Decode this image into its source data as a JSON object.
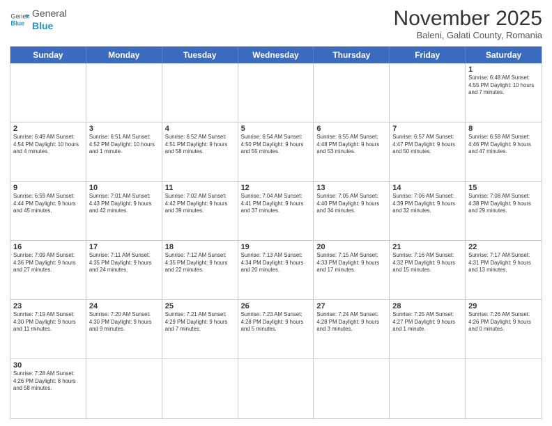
{
  "header": {
    "logo_general": "General",
    "logo_blue": "Blue",
    "month": "November 2025",
    "location": "Baleni, Galati County, Romania"
  },
  "weekdays": [
    "Sunday",
    "Monday",
    "Tuesday",
    "Wednesday",
    "Thursday",
    "Friday",
    "Saturday"
  ],
  "weeks": [
    [
      {
        "day": "",
        "info": ""
      },
      {
        "day": "",
        "info": ""
      },
      {
        "day": "",
        "info": ""
      },
      {
        "day": "",
        "info": ""
      },
      {
        "day": "",
        "info": ""
      },
      {
        "day": "",
        "info": ""
      },
      {
        "day": "1",
        "info": "Sunrise: 6:48 AM\nSunset: 4:55 PM\nDaylight: 10 hours and 7 minutes."
      }
    ],
    [
      {
        "day": "2",
        "info": "Sunrise: 6:49 AM\nSunset: 4:54 PM\nDaylight: 10 hours and 4 minutes."
      },
      {
        "day": "3",
        "info": "Sunrise: 6:51 AM\nSunset: 4:52 PM\nDaylight: 10 hours and 1 minute."
      },
      {
        "day": "4",
        "info": "Sunrise: 6:52 AM\nSunset: 4:51 PM\nDaylight: 9 hours and 58 minutes."
      },
      {
        "day": "5",
        "info": "Sunrise: 6:54 AM\nSunset: 4:50 PM\nDaylight: 9 hours and 55 minutes."
      },
      {
        "day": "6",
        "info": "Sunrise: 6:55 AM\nSunset: 4:48 PM\nDaylight: 9 hours and 53 minutes."
      },
      {
        "day": "7",
        "info": "Sunrise: 6:57 AM\nSunset: 4:47 PM\nDaylight: 9 hours and 50 minutes."
      },
      {
        "day": "8",
        "info": "Sunrise: 6:58 AM\nSunset: 4:46 PM\nDaylight: 9 hours and 47 minutes."
      }
    ],
    [
      {
        "day": "9",
        "info": "Sunrise: 6:59 AM\nSunset: 4:44 PM\nDaylight: 9 hours and 45 minutes."
      },
      {
        "day": "10",
        "info": "Sunrise: 7:01 AM\nSunset: 4:43 PM\nDaylight: 9 hours and 42 minutes."
      },
      {
        "day": "11",
        "info": "Sunrise: 7:02 AM\nSunset: 4:42 PM\nDaylight: 9 hours and 39 minutes."
      },
      {
        "day": "12",
        "info": "Sunrise: 7:04 AM\nSunset: 4:41 PM\nDaylight: 9 hours and 37 minutes."
      },
      {
        "day": "13",
        "info": "Sunrise: 7:05 AM\nSunset: 4:40 PM\nDaylight: 9 hours and 34 minutes."
      },
      {
        "day": "14",
        "info": "Sunrise: 7:06 AM\nSunset: 4:39 PM\nDaylight: 9 hours and 32 minutes."
      },
      {
        "day": "15",
        "info": "Sunrise: 7:08 AM\nSunset: 4:38 PM\nDaylight: 9 hours and 29 minutes."
      }
    ],
    [
      {
        "day": "16",
        "info": "Sunrise: 7:09 AM\nSunset: 4:36 PM\nDaylight: 9 hours and 27 minutes."
      },
      {
        "day": "17",
        "info": "Sunrise: 7:11 AM\nSunset: 4:35 PM\nDaylight: 9 hours and 24 minutes."
      },
      {
        "day": "18",
        "info": "Sunrise: 7:12 AM\nSunset: 4:35 PM\nDaylight: 9 hours and 22 minutes."
      },
      {
        "day": "19",
        "info": "Sunrise: 7:13 AM\nSunset: 4:34 PM\nDaylight: 9 hours and 20 minutes."
      },
      {
        "day": "20",
        "info": "Sunrise: 7:15 AM\nSunset: 4:33 PM\nDaylight: 9 hours and 17 minutes."
      },
      {
        "day": "21",
        "info": "Sunrise: 7:16 AM\nSunset: 4:32 PM\nDaylight: 9 hours and 15 minutes."
      },
      {
        "day": "22",
        "info": "Sunrise: 7:17 AM\nSunset: 4:31 PM\nDaylight: 9 hours and 13 minutes."
      }
    ],
    [
      {
        "day": "23",
        "info": "Sunrise: 7:19 AM\nSunset: 4:30 PM\nDaylight: 9 hours and 11 minutes."
      },
      {
        "day": "24",
        "info": "Sunrise: 7:20 AM\nSunset: 4:30 PM\nDaylight: 9 hours and 9 minutes."
      },
      {
        "day": "25",
        "info": "Sunrise: 7:21 AM\nSunset: 4:29 PM\nDaylight: 9 hours and 7 minutes."
      },
      {
        "day": "26",
        "info": "Sunrise: 7:23 AM\nSunset: 4:28 PM\nDaylight: 9 hours and 5 minutes."
      },
      {
        "day": "27",
        "info": "Sunrise: 7:24 AM\nSunset: 4:28 PM\nDaylight: 9 hours and 3 minutes."
      },
      {
        "day": "28",
        "info": "Sunrise: 7:25 AM\nSunset: 4:27 PM\nDaylight: 9 hours and 1 minute."
      },
      {
        "day": "29",
        "info": "Sunrise: 7:26 AM\nSunset: 4:26 PM\nDaylight: 9 hours and 0 minutes."
      }
    ],
    [
      {
        "day": "30",
        "info": "Sunrise: 7:28 AM\nSunset: 4:26 PM\nDaylight: 8 hours and 58 minutes."
      },
      {
        "day": "",
        "info": ""
      },
      {
        "day": "",
        "info": ""
      },
      {
        "day": "",
        "info": ""
      },
      {
        "day": "",
        "info": ""
      },
      {
        "day": "",
        "info": ""
      },
      {
        "day": "",
        "info": ""
      }
    ]
  ]
}
